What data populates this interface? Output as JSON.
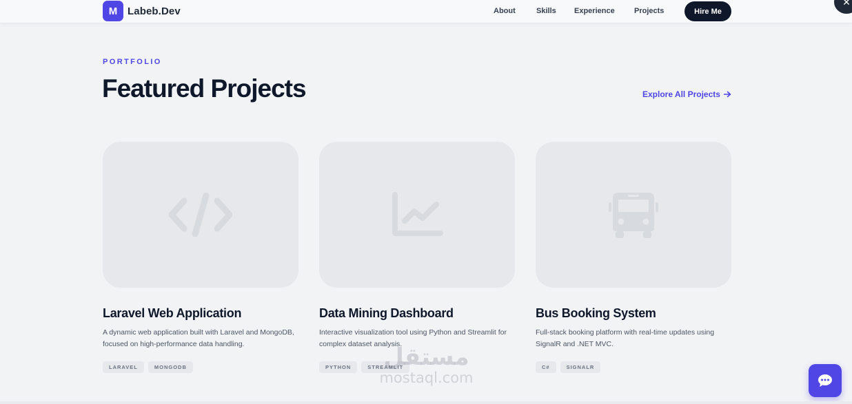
{
  "nav": {
    "logo_mark": "M",
    "logo_text": "Labeb.Dev",
    "links": [
      "About",
      "Skills",
      "Experience",
      "Projects"
    ],
    "hire_label": "Hire Me",
    "close_glyph": "✕"
  },
  "header": {
    "eyebrow": "PORTFOLIO",
    "title": "Featured Projects",
    "explore_label": "Explore All Projects"
  },
  "projects": [
    {
      "icon": "code-icon",
      "title": "Laravel Web Application",
      "description": "A dynamic web application built with Laravel and MongoDB, focused on high-performance data handling.",
      "tags": [
        "LARAVEL",
        "MONGODB"
      ]
    },
    {
      "icon": "line-chart-icon",
      "title": "Data Mining Dashboard",
      "description": "Interactive visualization tool using Python and Streamlit for complex dataset analysis.",
      "tags": [
        "PYTHON",
        "STREAMLIT"
      ]
    },
    {
      "icon": "bus-icon",
      "title": "Bus Booking System",
      "description": "Full-stack booking platform with real-time updates using SignalR and .NET MVC.",
      "tags": [
        "C#",
        "SIGNALR"
      ]
    }
  ],
  "watermark": {
    "arabic": "مستقل",
    "latin": "mostaql.com"
  },
  "colors": {
    "accent": "#4f46e5",
    "dark": "#0f172a",
    "background": "#f2f3f5",
    "card": "#e6e8ec"
  }
}
